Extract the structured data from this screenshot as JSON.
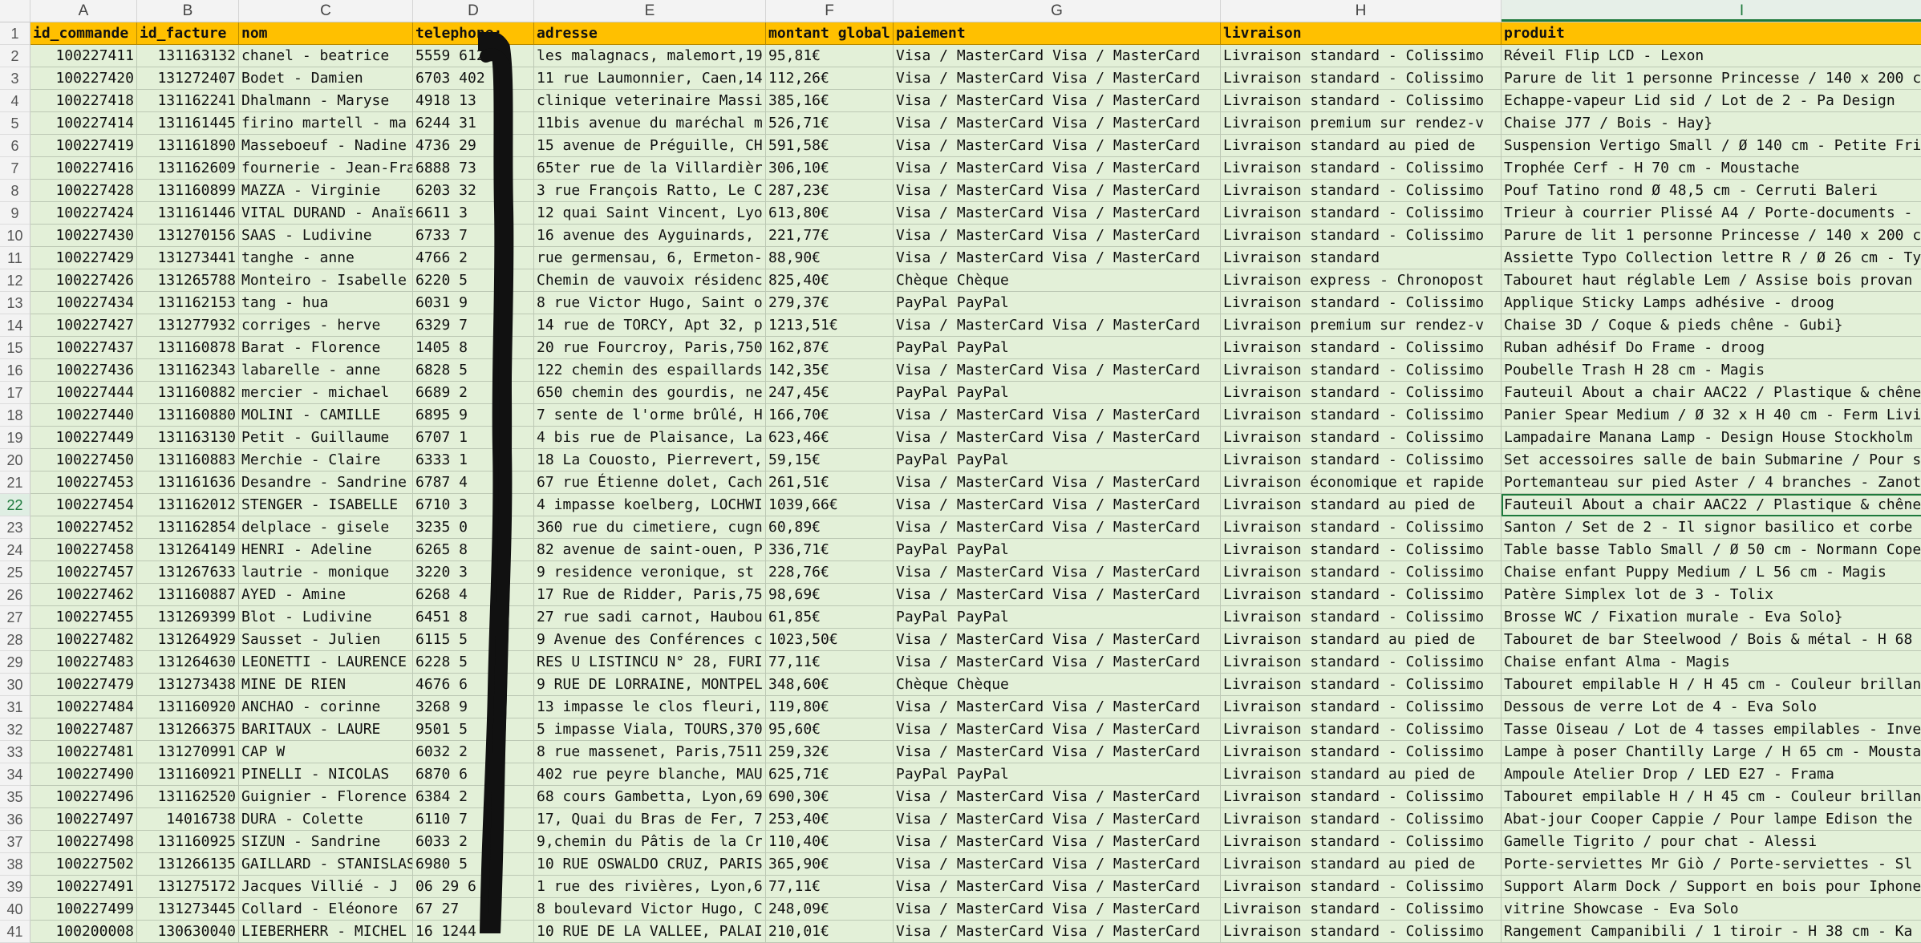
{
  "spreadsheet": {
    "column_letters": [
      "A",
      "B",
      "C",
      "D",
      "E",
      "F",
      "G",
      "H",
      "I"
    ],
    "active_column": "I",
    "active_row": "22",
    "header_row_number": "1",
    "headers": [
      "id_commande",
      "id_facture",
      "nom",
      "telephone:",
      "adresse",
      "montant global",
      "paiement",
      "livraison",
      "produit"
    ],
    "rows": [
      {
        "n": "2",
        "c": [
          "100227411",
          "131163132",
          "chanel - beatrice",
          "5559 612",
          "les malagnacs, malemort,19",
          "95,81€",
          "Visa / MasterCard Visa / MasterCard",
          "Livraison standard - Colissimo",
          "Réveil Flip LCD - Lexon"
        ]
      },
      {
        "n": "3",
        "c": [
          "100227420",
          "131272407",
          "Bodet - Damien",
          "6703 402",
          "11 rue Laumonnier, Caen,14",
          "112,26€",
          "Visa / MasterCard Visa / MasterCard",
          "Livraison standard - Colissimo",
          "Parure de lit 1 personne Princesse / 140 x 200 c"
        ]
      },
      {
        "n": "4",
        "c": [
          "100227418",
          "131162241",
          "Dhalmann - Maryse",
          "4918 13",
          "clinique veterinaire Massi",
          "385,16€",
          "Visa / MasterCard Visa / MasterCard",
          "Livraison standard - Colissimo",
          "Echappe-vapeur Lid sid / Lot de 2 - Pa Design"
        ]
      },
      {
        "n": "5",
        "c": [
          "100227414",
          "131161445",
          "firino martell - ma",
          "6244 31",
          "11bis avenue du maréchal m",
          "526,71€",
          "Visa / MasterCard Visa / MasterCard",
          "Livraison premium sur rendez-v",
          "Chaise J77 / Bois - Hay}"
        ]
      },
      {
        "n": "6",
        "c": [
          "100227419",
          "131161890",
          "Masseboeuf - Nadine",
          "4736 29",
          "15 avenue de Préguille, CH",
          "591,58€",
          "Visa / MasterCard Visa / MasterCard",
          "Livraison standard au pied de",
          "Suspension Vertigo Small / Ø 140 cm - Petite Fri"
        ]
      },
      {
        "n": "7",
        "c": [
          "100227416",
          "131162609",
          "fournerie - Jean-Fra",
          "6888 73",
          "65ter rue de la Villardièr",
          "306,10€",
          "Visa / MasterCard Visa / MasterCard",
          "Livraison standard - Colissimo",
          "Trophée Cerf - H 70 cm - Moustache"
        ]
      },
      {
        "n": "8",
        "c": [
          "100227428",
          "131160899",
          "MAZZA - Virginie",
          "6203 32",
          "3 rue François Ratto, Le C",
          "287,23€",
          "Visa / MasterCard Visa / MasterCard",
          "Livraison standard - Colissimo",
          "Pouf Tatino rond Ø 48,5 cm - Cerruti Baleri"
        ]
      },
      {
        "n": "9",
        "c": [
          "100227424",
          "131161446",
          "VITAL DURAND - Anaïs",
          "6611 3",
          "12 quai Saint Vincent, Lyo",
          "613,80€",
          "Visa / MasterCard Visa / MasterCard",
          "Livraison standard - Colissimo",
          "Trieur à courrier Plissé A4 / Porte-documents -"
        ]
      },
      {
        "n": "10",
        "c": [
          "100227430",
          "131270156",
          "SAAS - Ludivine",
          "6733 7",
          "16 avenue des Ayguinards, ",
          "221,77€",
          "Visa / MasterCard Visa / MasterCard",
          "Livraison standard - Colissimo",
          "Parure de lit 1 personne Princesse / 140 x 200 c"
        ]
      },
      {
        "n": "11",
        "c": [
          "100227429",
          "131273441",
          "tanghe - anne",
          "4766 2",
          "rue germensau, 6, Ermeton-",
          "88,90€",
          "Visa / MasterCard Visa / MasterCard",
          "Livraison standard",
          "Assiette Typo Collection lettre R / Ø 26 cm - Ty"
        ]
      },
      {
        "n": "12",
        "c": [
          "100227426",
          "131265788",
          "Monteiro - Isabelle",
          "6220 5",
          "Chemin de vauvoix résidenc",
          "825,40€",
          "Chèque Chèque",
          "Livraison express - Chronopost",
          "Tabouret haut réglable Lem / Assise bois provan"
        ]
      },
      {
        "n": "13",
        "c": [
          "100227434",
          "131162153",
          "tang - hua",
          "6031 9",
          "8 rue Victor Hugo, Saint o",
          "279,37€",
          "PayPal PayPal",
          "Livraison standard - Colissimo",
          "Applique Sticky Lamps adhésive - droog"
        ]
      },
      {
        "n": "14",
        "c": [
          "100227427",
          "131277932",
          "corriges - herve",
          "6329 7",
          "14 rue de TORCY, Apt 32, p",
          "1213,51€",
          "Visa / MasterCard Visa / MasterCard",
          "Livraison premium sur rendez-v",
          "Chaise 3D / Coque & pieds chêne - Gubi}"
        ]
      },
      {
        "n": "15",
        "c": [
          "100227437",
          "131160878",
          "Barat - Florence",
          "1405 8",
          "20 rue Fourcroy, Paris,750",
          "162,87€",
          "PayPal PayPal",
          "Livraison standard - Colissimo",
          "Ruban adhésif Do Frame - droog"
        ]
      },
      {
        "n": "16",
        "c": [
          "100227436",
          "131162343",
          "labarelle - anne",
          "6828 5",
          "122 chemin des espaillards",
          "142,35€",
          "Visa / MasterCard Visa / MasterCard",
          "Livraison standard - Colissimo",
          "Poubelle Trash H 28 cm - Magis"
        ]
      },
      {
        "n": "17",
        "c": [
          "100227444",
          "131160882",
          "mercier - michael",
          "6689 2",
          "650 chemin des gourdis, ne",
          "247,45€",
          "PayPal PayPal",
          "Livraison standard - Colissimo",
          "Fauteuil About a chair AAC22 / Plastique & chêne"
        ]
      },
      {
        "n": "18",
        "c": [
          "100227440",
          "131160880",
          "MOLINI - CAMILLE",
          "6895 9",
          "7 sente de l'orme brûlé, H",
          "166,70€",
          "Visa / MasterCard Visa / MasterCard",
          "Livraison standard - Colissimo",
          "Panier Spear Medium / Ø 32 x H 40 cm - Ferm Livi"
        ]
      },
      {
        "n": "19",
        "c": [
          "100227449",
          "131163130",
          "Petit - Guillaume",
          "6707 1",
          "4 bis rue de Plaisance, La",
          "623,46€",
          "Visa / MasterCard Visa / MasterCard",
          "Livraison standard - Colissimo",
          "Lampadaire Manana Lamp - Design House Stockholm"
        ]
      },
      {
        "n": "20",
        "c": [
          "100227450",
          "131160883",
          "Merchie - Claire",
          "6333 1",
          "18 La Couosto, Pierrevert,",
          "59,15€",
          "PayPal PayPal",
          "Livraison standard - Colissimo",
          "Set accessoires salle de bain Submarine / Pour s"
        ]
      },
      {
        "n": "21",
        "c": [
          "100227453",
          "131161636",
          "Desandre - Sandrine",
          "6787 4",
          "67 rue Étienne dolet, Cach",
          "261,51€",
          "Visa / MasterCard Visa / MasterCard",
          "Livraison économique et rapide",
          "Portemanteau sur pied Aster / 4 branches - Zanot"
        ]
      },
      {
        "n": "22",
        "c": [
          "100227454",
          "131162012",
          "STENGER - ISABELLE",
          "6710 3",
          "4 impasse koelberg, LOCHWI",
          "1039,66€",
          "Visa / MasterCard Visa / MasterCard",
          "Livraison standard au pied de",
          "Fauteuil About a chair AAC22 / Plastique & chêne"
        ]
      },
      {
        "n": "23",
        "c": [
          "100227452",
          "131162854",
          "delplace - gisele",
          "3235 0",
          "360 rue du cimetiere, cugn",
          "60,89€",
          "Visa / MasterCard Visa / MasterCard",
          "Livraison standard - Colissimo",
          "Santon / Set de 2 -  Il signor basilico et corbe"
        ]
      },
      {
        "n": "24",
        "c": [
          "100227458",
          "131264149",
          "HENRI - Adeline",
          "6265 8",
          "82 avenue de saint-ouen, P",
          "336,71€",
          "PayPal PayPal",
          "Livraison standard - Colissimo",
          "Table basse Tablo Small / Ø 50 cm - Normann Cope"
        ]
      },
      {
        "n": "25",
        "c": [
          "100227457",
          "131267633",
          "lautrie - monique",
          "3220 3",
          "9 residence veronique, st ",
          "228,76€",
          "Visa / MasterCard Visa / MasterCard",
          "Livraison standard - Colissimo",
          "Chaise enfant Puppy Medium / L 56 cm - Magis"
        ]
      },
      {
        "n": "26",
        "c": [
          "100227462",
          "131160887",
          "AYED - Amine",
          "6268 4",
          "17 Rue de Ridder, Paris,75",
          "98,69€",
          "Visa / MasterCard Visa / MasterCard",
          "Livraison standard - Colissimo",
          "Patère Simplex lot de 3 - Tolix"
        ]
      },
      {
        "n": "27",
        "c": [
          "100227455",
          "131269399",
          "Blot - Ludivine",
          "6451 8",
          "27 rue sadi carnot, Haubou",
          "61,85€",
          "PayPal PayPal",
          "Livraison standard - Colissimo",
          "Brosse WC / Fixation murale - Eva Solo}"
        ]
      },
      {
        "n": "28",
        "c": [
          "100227482",
          "131264929",
          "Sausset - Julien",
          "6115 5",
          "9 Avenue des Conférences c",
          "1023,50€",
          "Visa / MasterCard Visa / MasterCard",
          "Livraison standard au pied de",
          "Tabouret de bar Steelwood / Bois & métal - H 68"
        ]
      },
      {
        "n": "29",
        "c": [
          "100227483",
          "131264630",
          "LEONETTI - LAURENCE",
          "6228 5",
          "RES U LISTINCU N° 28, FURI",
          "77,11€",
          "Visa / MasterCard Visa / MasterCard",
          "Livraison standard - Colissimo",
          "Chaise enfant Alma - Magis"
        ]
      },
      {
        "n": "30",
        "c": [
          "100227479",
          "131273438",
          "MINE DE RIEN",
          "4676 6",
          "9 RUE DE LORRAINE, MONTPEL",
          "348,60€",
          "Chèque Chèque",
          "Livraison standard - Colissimo",
          "Tabouret empilable H / H 45 cm - Couleur brillan"
        ]
      },
      {
        "n": "31",
        "c": [
          "100227484",
          "131160920",
          "ANCHAO - corinne",
          "3268 9",
          "13 impasse le clos fleuri,",
          "119,80€",
          "Visa / MasterCard Visa / MasterCard",
          "Livraison standard - Colissimo",
          "Dessous de verre Lot de 4 - Eva Solo"
        ]
      },
      {
        "n": "32",
        "c": [
          "100227487",
          "131266375",
          "BARITAUX - LAURE",
          "9501 5",
          "5 impasse Viala, TOURS,370",
          "95,60€",
          "Visa / MasterCard Visa / MasterCard",
          "Livraison standard - Colissimo",
          "Tasse Oiseau / Lot de 4 tasses empilables - Inve"
        ]
      },
      {
        "n": "33",
        "c": [
          "100227481",
          "131270991",
          "CAP W",
          "6032 2",
          "8 rue massenet, Paris,7511",
          "259,32€",
          "Visa / MasterCard Visa / MasterCard",
          "Livraison standard - Colissimo",
          "Lampe à poser Chantilly Large / H 65 cm - Mousta"
        ]
      },
      {
        "n": "34",
        "c": [
          "100227490",
          "131160921",
          "PINELLI - NICOLAS",
          "6870 6",
          "402 rue peyre blanche, MAU",
          "625,71€",
          "PayPal PayPal",
          "Livraison standard au pied de",
          "Ampoule Atelier Drop / LED E27 - Frama"
        ]
      },
      {
        "n": "35",
        "c": [
          "100227496",
          "131162520",
          "Guignier - Florence",
          "6384 2",
          "68 cours Gambetta, Lyon,69",
          "690,30€",
          "Visa / MasterCard Visa / MasterCard",
          "Livraison standard - Colissimo",
          "Tabouret empilable H / H 45 cm - Couleur brillan"
        ]
      },
      {
        "n": "36",
        "c": [
          "100227497",
          "14016738",
          "DURA - Colette",
          "6110 7",
          "17, Quai du Bras de Fer, 7",
          "253,40€",
          "Visa / MasterCard Visa / MasterCard",
          "Livraison standard - Colissimo",
          "Abat-jour Cooper Cappie / Pour lampe Edison the"
        ]
      },
      {
        "n": "37",
        "c": [
          "100227498",
          "131160925",
          "SIZUN - Sandrine",
          "6033 2",
          "9,chemin du Pâtis de la Cr",
          "110,40€",
          "Visa / MasterCard Visa / MasterCard",
          "Livraison standard - Colissimo",
          "Gamelle Tigrito / pour chat - Alessi"
        ]
      },
      {
        "n": "38",
        "c": [
          "100227502",
          "131266135",
          "GAILLARD - STANISLAS",
          "6980 5",
          "10 RUE OSWALDO CRUZ, PARIS",
          "365,90€",
          "Visa / MasterCard Visa / MasterCard",
          "Livraison standard au pied de",
          "Porte-serviettes Mr Giò / Porte-serviettes - Sl"
        ]
      },
      {
        "n": "39",
        "c": [
          "100227491",
          "131275172",
          "Jacques Villié  - J",
          "06 29 6 28",
          "1 rue des rivières, Lyon,6",
          "77,11€",
          "Visa / MasterCard Visa / MasterCard",
          "Livraison standard - Colissimo",
          "Support Alarm Dock / Support en bois pour Iphone"
        ]
      },
      {
        "n": "40",
        "c": [
          "100227499",
          "131273445",
          "Collard - Eléonore",
          "67 27",
          "8 boulevard Victor Hugo, C",
          "248,09€",
          "Visa / MasterCard Visa / MasterCard",
          "Livraison standard - Colissimo",
          "vitrine Showcase - Eva Solo"
        ]
      },
      {
        "n": "41",
        "c": [
          "100200008",
          "130630040",
          "LIEBERHERR - MICHEL",
          "16 1244",
          "10 RUE DE LA VALLEE, PALAI",
          "210,01€",
          "Visa / MasterCard Visa / MasterCard",
          "Livraison standard - Colissimo",
          "Rangement Campanibili / 1 tiroir - H 38 cm - Ka"
        ]
      }
    ]
  }
}
